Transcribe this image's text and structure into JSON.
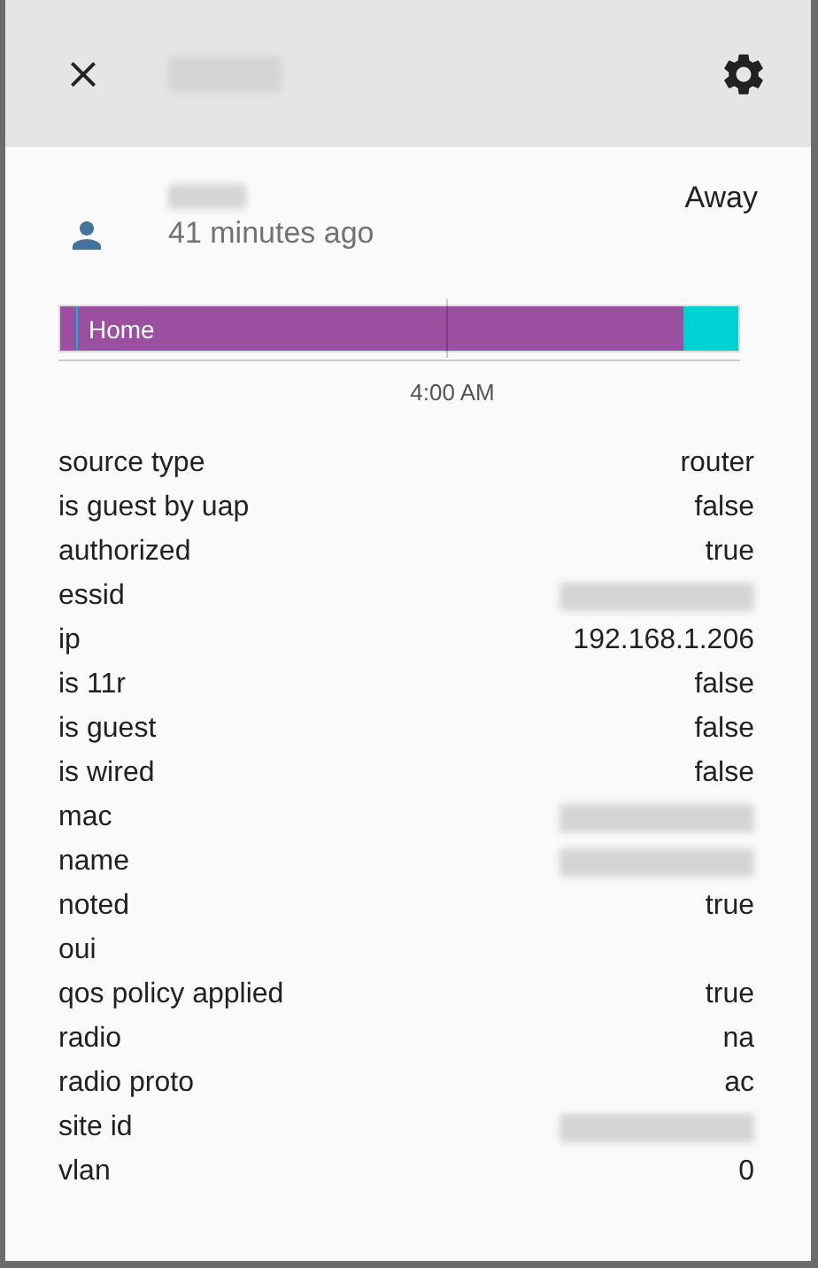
{
  "dialog": {
    "title_redacted": true
  },
  "entity": {
    "name_redacted": true,
    "last_changed": "41 minutes ago",
    "state": "Away"
  },
  "timeline": {
    "segments": [
      {
        "label": "Home",
        "color": "#9b4fa0",
        "level": 0.92
      },
      {
        "color": "#00d1d3",
        "level": 0.08
      }
    ],
    "tick": "4:00 AM"
  },
  "attributes": [
    {
      "name": "source type",
      "value": "router"
    },
    {
      "name": "is guest by uap",
      "value": "false"
    },
    {
      "name": "authorized",
      "value": "true"
    },
    {
      "name": "essid",
      "redacted": true
    },
    {
      "name": "ip",
      "value": "192.168.1.206"
    },
    {
      "name": "is 11r",
      "value": "false"
    },
    {
      "name": "is guest",
      "value": "false"
    },
    {
      "name": "is wired",
      "value": "false"
    },
    {
      "name": "mac",
      "redacted": true
    },
    {
      "name": "name",
      "redacted": true
    },
    {
      "name": "noted",
      "value": "true"
    },
    {
      "name": "oui"
    },
    {
      "name": "qos policy applied",
      "value": "true"
    },
    {
      "name": "radio",
      "value": "na"
    },
    {
      "name": "radio proto",
      "value": "ac"
    },
    {
      "name": "site id",
      "redacted": true
    },
    {
      "name": "vlan",
      "value": "0"
    }
  ]
}
